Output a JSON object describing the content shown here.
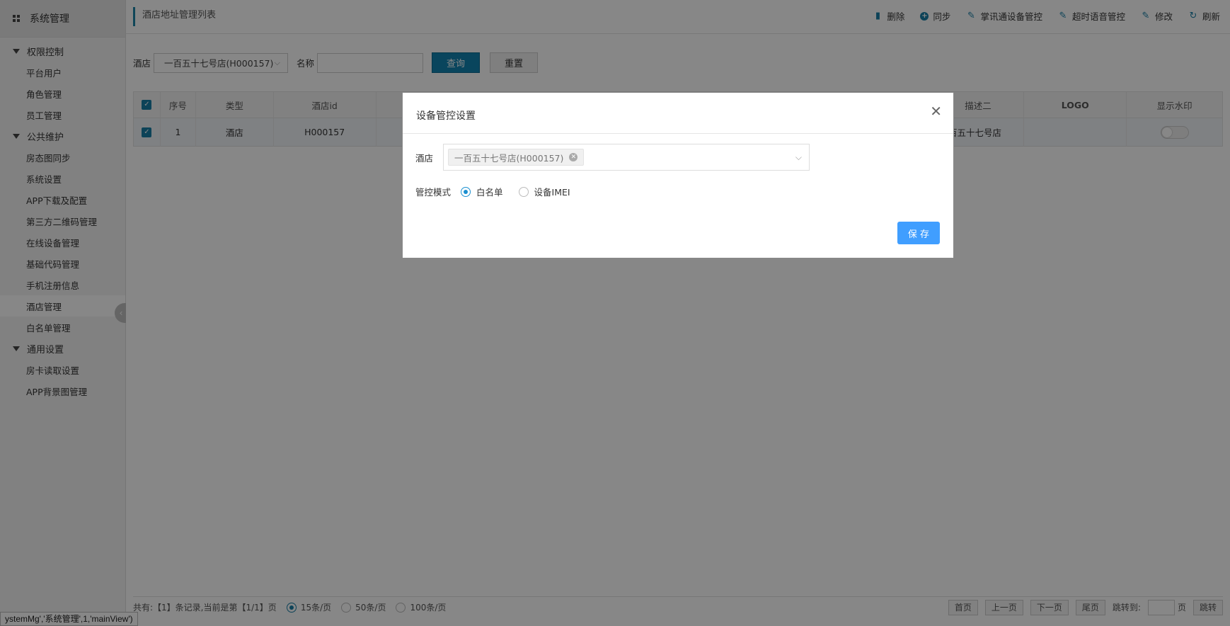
{
  "sidebar": {
    "header": "系统管理",
    "groups": [
      {
        "label": "权限控制",
        "items": [
          "平台用户",
          "角色管理",
          "员工管理"
        ]
      },
      {
        "label": "公共维护",
        "items": [
          "房态图同步",
          "系统设置",
          "APP下载及配置",
          "第三方二维码管理",
          "在线设备管理",
          "基础代码管理",
          "手机注册信息",
          "酒店管理",
          "白名单管理"
        ]
      },
      {
        "label": "通用设置",
        "items": [
          "房卡读取设置",
          "APP背景图管理"
        ]
      }
    ],
    "active_item": "酒店管理"
  },
  "header": {
    "title": "酒店地址管理列表",
    "toolbar": [
      {
        "label": "删除",
        "icon": "trash-icon"
      },
      {
        "label": "同步",
        "icon": "plus-circle-icon"
      },
      {
        "label": "掌讯通设备管控",
        "icon": "pencil-icon"
      },
      {
        "label": "超时语音管控",
        "icon": "pencil-icon"
      },
      {
        "label": "修改",
        "icon": "pencil-icon"
      },
      {
        "label": "刷新",
        "icon": "refresh-icon"
      }
    ]
  },
  "filters": {
    "hotel_label": "酒店",
    "hotel_value": "一百五十七号店(H000157)",
    "name_label": "名称",
    "name_value": "",
    "query_label": "查询",
    "reset_label": "重置"
  },
  "table": {
    "columns": [
      "序号",
      "类型",
      "酒店id",
      "描述二",
      "LOGO",
      "显示水印"
    ],
    "rows": [
      {
        "index": "1",
        "type": "酒店",
        "hotel_id": "H000157",
        "desc2": "一百五十七号店",
        "logo": "",
        "watermark": false
      }
    ]
  },
  "pager": {
    "summary": "共有:【1】条记录,当前是第【1/1】页",
    "sizes": [
      "15条/页",
      "50条/页",
      "100条/页"
    ],
    "selected_size": "15条/页",
    "first": "首页",
    "prev": "上一页",
    "next": "下一页",
    "last": "尾页",
    "jump_label": "跳转到:",
    "page_unit": "页",
    "jump_btn": "跳转"
  },
  "status_tip": "ystemMg','系统管理',1,'mainView')",
  "modal": {
    "title": "设备管控设置",
    "hotel_label": "酒店",
    "hotel_tag": "一百五十七号店(H000157)",
    "mode_label": "管控模式",
    "options": [
      "白名单",
      "设备IMEI"
    ],
    "selected_option": "白名单",
    "save_label": "保 存"
  },
  "colors": {
    "accent": "#1a7fa6",
    "query_button": "#1283b0",
    "save_button": "#409eff"
  }
}
